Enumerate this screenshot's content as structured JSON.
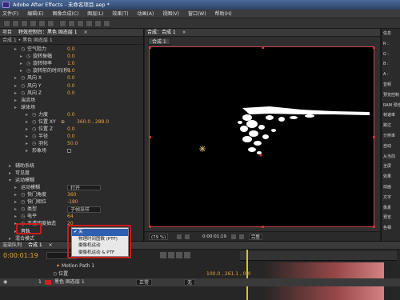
{
  "app": {
    "title": "Adobe After Effects - 未命名项目.aep *"
  },
  "menu": [
    "文件(F)",
    "编辑(E)",
    "图像合成(C)",
    "图层(L)",
    "效果(T)",
    "动画(A)",
    "视图(V)",
    "窗口(W)",
    "帮助(H)"
  ],
  "left_panel": {
    "tabs": [
      "项目",
      "特效控制台：黑色 固态层 1",
      "×"
    ],
    "breadcrumb": "合成 1 • 黑色 固态层 1",
    "properties": [
      {
        "label": "空气阻力",
        "value": "0.0",
        "indent": 2,
        "sw": true
      },
      {
        "label": "旋转振幅",
        "value": "0.0",
        "indent": 3,
        "sw": true
      },
      {
        "label": "旋转频率",
        "value": "1.0",
        "indent": 3,
        "sw": true
      },
      {
        "label": "旋转前的时间(秒)",
        "value": "1.0",
        "indent": 3,
        "sw": true
      },
      {
        "label": "风向 X",
        "value": "0.0",
        "indent": 2,
        "sw": true
      },
      {
        "label": "风向 Y",
        "value": "0.0",
        "indent": 2,
        "sw": true
      },
      {
        "label": "风向 Z",
        "value": "0.0",
        "indent": 2,
        "sw": true
      },
      {
        "label": "湍流场",
        "value": "",
        "indent": 2,
        "sw": false
      },
      {
        "label": "球体场",
        "value": "",
        "indent": 2,
        "sw": false
      },
      {
        "label": "力度",
        "value": "0.0",
        "indent": 4,
        "sw": true
      },
      {
        "label": "位置 XY",
        "value": "360.0 , 288.0",
        "indent": 4,
        "sw": true,
        "crosshair": true
      },
      {
        "label": "位置 Z",
        "value": "0.0",
        "indent": 4,
        "sw": true
      },
      {
        "label": "半径",
        "value": "0.0",
        "indent": 4,
        "sw": true
      },
      {
        "label": "羽化",
        "value": "50.0",
        "indent": 4,
        "sw": true
      },
      {
        "label": "形象场",
        "value": "",
        "indent": 4,
        "sw": false,
        "checkbox": true
      },
      {
        "label": "",
        "value": "",
        "indent": 0,
        "sw": false
      },
      {
        "label": "辅助系统",
        "value": "",
        "indent": 1,
        "sw": false
      },
      {
        "label": "可见度",
        "value": "",
        "indent": 1,
        "sw": false
      },
      {
        "label": "运动模糊",
        "value": "",
        "indent": 1,
        "sw": false,
        "open": true
      },
      {
        "label": "运动模糊",
        "value": "打开",
        "indent": 2,
        "sw": false,
        "dropdown": true
      },
      {
        "label": "快门角度",
        "value": "360",
        "indent": 2,
        "sw": true
      },
      {
        "label": "快门相位",
        "value": "-180",
        "indent": 2,
        "sw": true
      },
      {
        "label": "类型",
        "value": "子帧采样",
        "indent": 2,
        "sw": true,
        "dropdown": true
      },
      {
        "label": "电平",
        "value": "64",
        "indent": 2,
        "sw": true
      },
      {
        "label": "不透明度抽造",
        "value": "20",
        "indent": 2,
        "sw": true
      },
      {
        "label": "音轨",
        "value": "",
        "indent": 2,
        "sw": false,
        "highlight": true
      },
      {
        "label": "混合模式",
        "value": "",
        "indent": 1,
        "sw": false
      }
    ]
  },
  "viewer": {
    "tabs": [
      "合成：合成 1",
      "×"
    ],
    "subtab": "合成 1",
    "zoom": "(79 %)",
    "timecode": "0:00:01:19",
    "quality": "完整"
  },
  "right_panel": {
    "labels": [
      "信息",
      "R :",
      "G :",
      "B :",
      "A :",
      "音频",
      "预览控制",
      "RAM 预览",
      "帧速率",
      "跳过",
      "分辨率",
      "自动",
      "从当前",
      "全屏",
      "效果",
      "动画",
      "文字",
      "像素",
      "预览",
      "色相"
    ]
  },
  "dropdown_menu": {
    "items": [
      "关",
      "物理时间图数 (PTF)",
      "摄像机运动",
      "摄像机运动 & PTF"
    ],
    "selected": 0
  },
  "timeline": {
    "tabs": [
      "渲染队列",
      "合成 1",
      "×"
    ],
    "timecode": "0:00:01:19",
    "search_placeholder": "",
    "layers": [
      {
        "num": "",
        "name": "Motion Path 1",
        "icon": "star"
      },
      {
        "num": "",
        "name": "位置",
        "value": "100.0 , 261.1 , 0.0"
      },
      {
        "num": "1",
        "name": "黑色 固态层 1",
        "mode": "正常",
        "track": "无"
      }
    ]
  },
  "colors": {
    "accent": "#e8a33a",
    "highlight": "#c91d1d",
    "selected": "#2f5fb0"
  }
}
